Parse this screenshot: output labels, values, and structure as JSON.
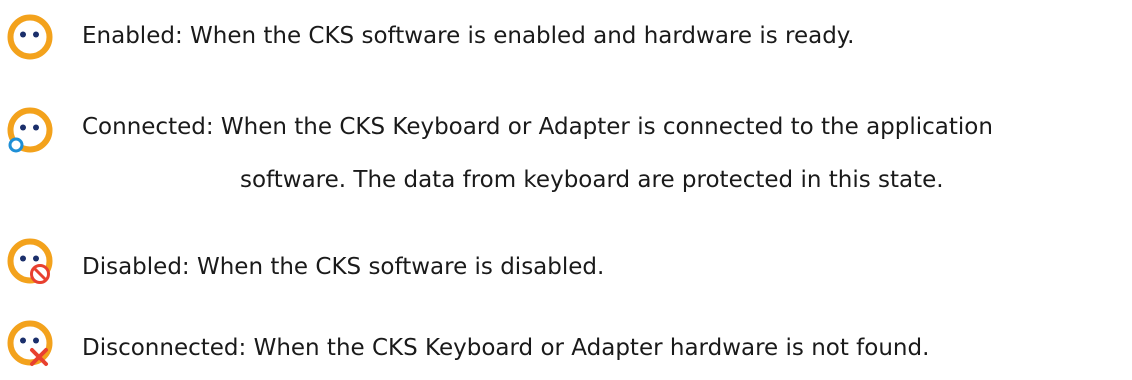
{
  "colors": {
    "face": "#f3a21c",
    "eyes": "#1b2f6b",
    "connected_badge": "#1e8fd6",
    "disabled_badge": "#e8402f",
    "disconnected_badge": "#e8402f"
  },
  "states": [
    {
      "icon": "smiley-enabled-icon",
      "lines": [
        "Enabled: When the CKS software is enabled and hardware is ready."
      ]
    },
    {
      "icon": "smiley-connected-icon",
      "lines": [
        "Connected: When the CKS Keyboard or Adapter is connected to the application",
        "software. The data from keyboard are protected in this state."
      ]
    },
    {
      "icon": "smiley-disabled-icon",
      "lines": [
        "Disabled: When the CKS software is disabled."
      ]
    },
    {
      "icon": "smiley-disconnected-icon",
      "lines": [
        "Disconnected: When the CKS Keyboard or Adapter hardware is not found."
      ]
    }
  ]
}
